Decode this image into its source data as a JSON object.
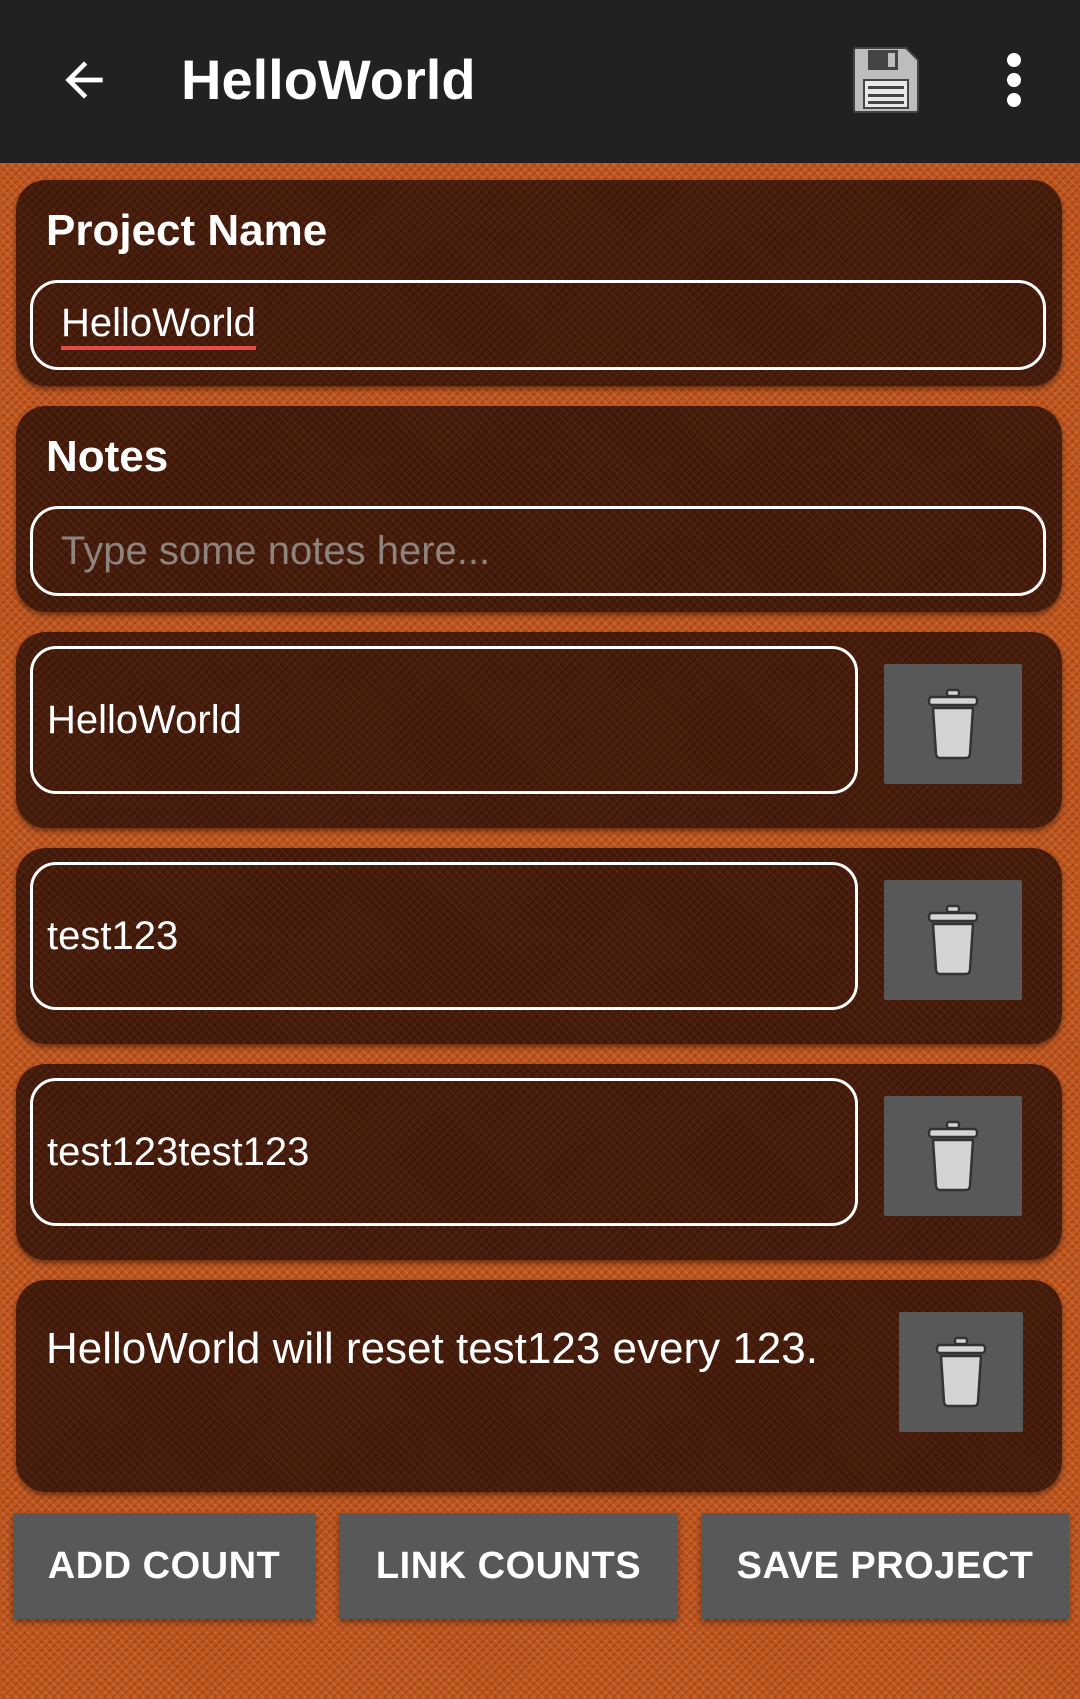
{
  "toolbar": {
    "title": "HelloWorld",
    "back_icon": "arrow-left-icon",
    "save_icon": "floppy-disk-icon",
    "menu_icon": "more-vertical-icon"
  },
  "project": {
    "label": "Project Name",
    "value": "HelloWorld"
  },
  "notes": {
    "label": "Notes",
    "placeholder": "Type some notes here..."
  },
  "counts": [
    {
      "name": "HelloWorld"
    },
    {
      "name": "test123"
    },
    {
      "name": "test123test123"
    }
  ],
  "link": {
    "text": "HelloWorld will reset test123 every 123."
  },
  "actions": {
    "add_count": "ADD COUNT",
    "link_counts": "LINK COUNTS",
    "save_project": "SAVE PROJECT"
  },
  "colors": {
    "app_bar": "#212121",
    "background": "#c2561e",
    "card": "#3a160a",
    "button": "#585858",
    "spellcheck_underline": "#e84a4a"
  }
}
